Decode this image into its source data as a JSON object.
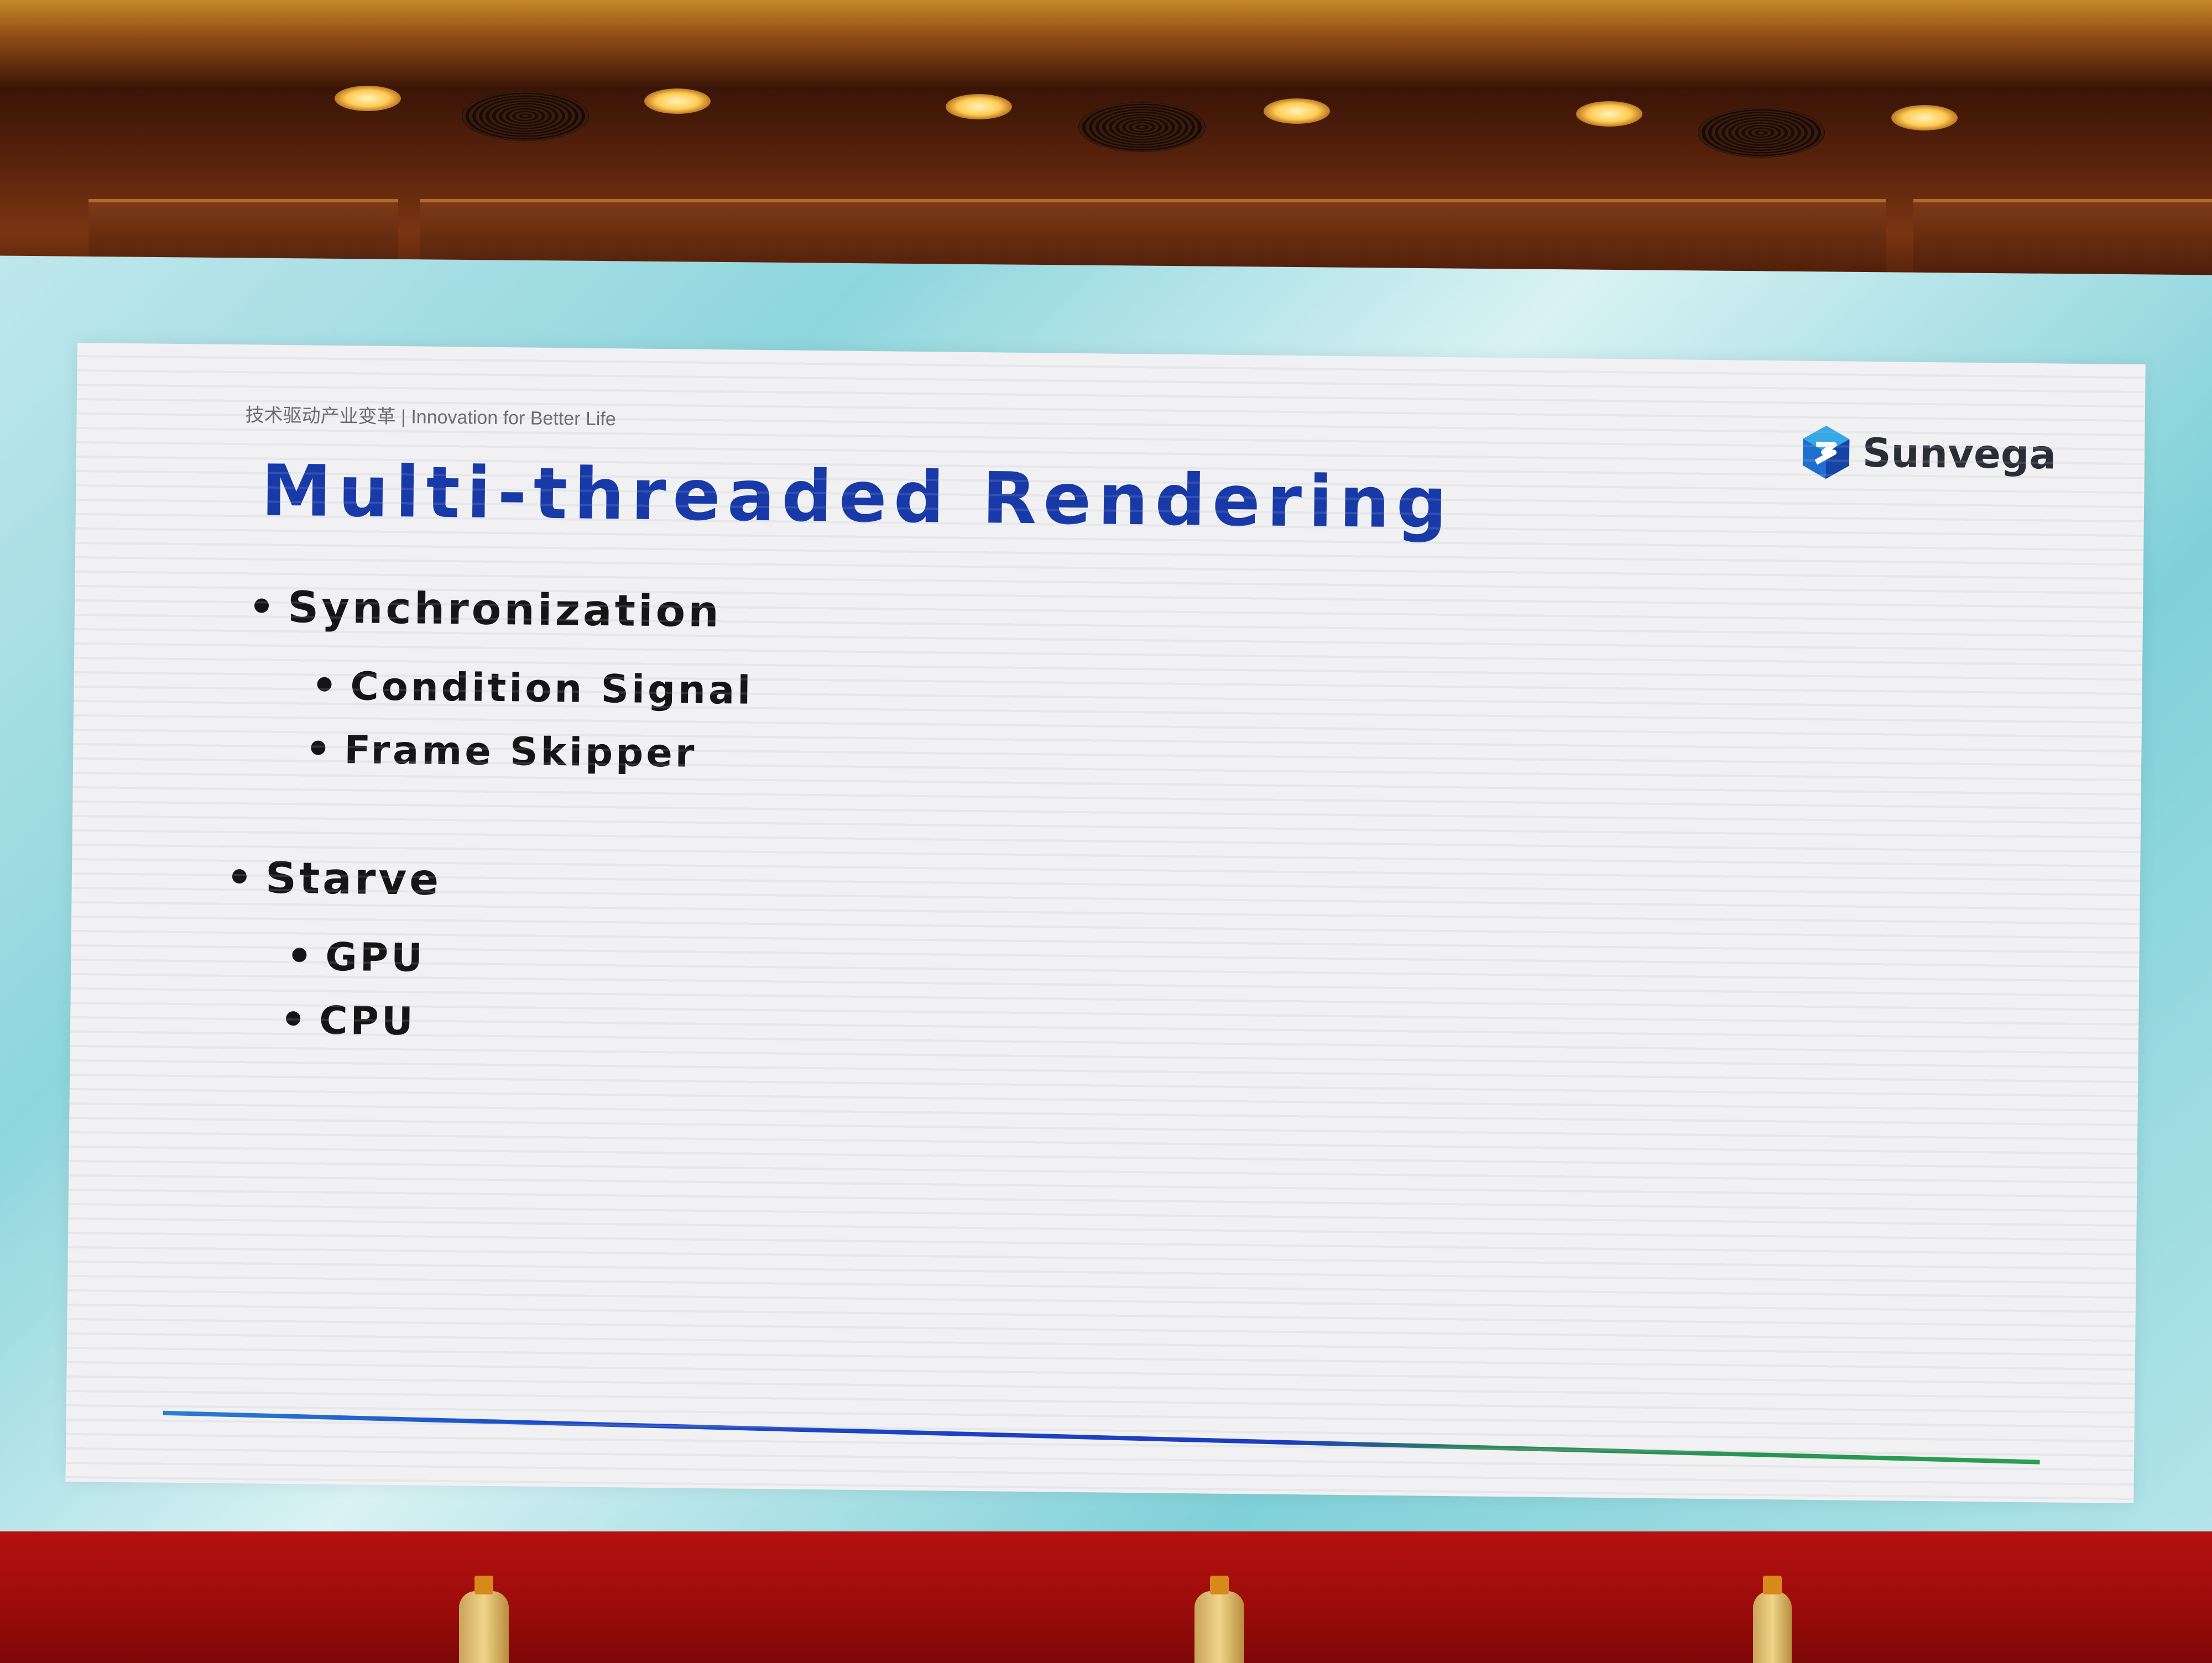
{
  "slide": {
    "tagline": "技术驱动产业变革 | Innovation for Better Life",
    "brand": "Sunvega",
    "brand_logo_icon": "sunvega-hex-logo-icon",
    "title": "Multi-threaded Rendering",
    "title_color": "#1839a8",
    "bullets": [
      {
        "label": "Synchronization",
        "children": [
          {
            "label": "Condition Signal"
          },
          {
            "label": "Frame Skipper"
          }
        ]
      },
      {
        "label": "Starve",
        "children": [
          {
            "label": "GPU"
          },
          {
            "label": "CPU"
          }
        ]
      }
    ],
    "footer_line_colors": [
      "#2a7fd0",
      "#1c3cbf",
      "#2aa050"
    ]
  }
}
